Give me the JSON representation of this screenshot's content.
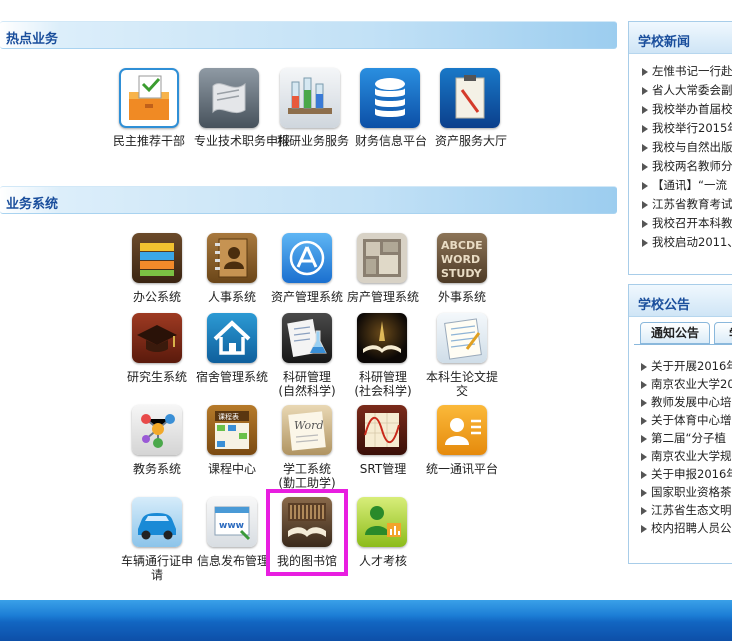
{
  "hot_services": {
    "title": "热点业务",
    "items": [
      {
        "label": "民主推荐干部",
        "icon": "ballot-box-icon"
      },
      {
        "label": "专业技术职务申报",
        "icon": "scroll-icon"
      },
      {
        "label": "科研业务服务",
        "icon": "lab-flasks-icon"
      },
      {
        "label": "财务信息平台",
        "icon": "database-icon"
      },
      {
        "label": "资产服务大厅",
        "icon": "clipboard-icon"
      }
    ]
  },
  "business_systems": {
    "title": "业务系统",
    "items": [
      {
        "label": "办公系统",
        "icon": "folders-icon"
      },
      {
        "label": "人事系统",
        "icon": "address-book-icon"
      },
      {
        "label": "资产管理系统",
        "icon": "app-store-icon"
      },
      {
        "label": "房产管理系统",
        "icon": "floor-plan-icon"
      },
      {
        "label": "外事系统",
        "icon": "abc-letters-icon"
      },
      {
        "label": "研究生系统",
        "icon": "graduation-cap-icon"
      },
      {
        "label": "宿舍管理系统",
        "icon": "house-icon"
      },
      {
        "label": "科研管理\n(自然科学)",
        "icon": "flask-notebook-icon"
      },
      {
        "label": "科研管理\n(社会科学)",
        "icon": "open-book-glow-icon"
      },
      {
        "label": "本科生论文提交",
        "icon": "notebook-icon"
      },
      {
        "label": "教务系统",
        "icon": "molecule-icon"
      },
      {
        "label": "课程中心",
        "icon": "timetable-icon"
      },
      {
        "label": "学工系统\n(勤工助学)",
        "icon": "word-document-icon"
      },
      {
        "label": "SRT管理",
        "icon": "graph-chart-icon"
      },
      {
        "label": "统一通讯平台",
        "icon": "contact-card-icon"
      },
      {
        "label": "车辆通行证申请",
        "icon": "car-icon"
      },
      {
        "label": "信息发布管理",
        "icon": "www-browser-icon"
      },
      {
        "label": "我的图书馆",
        "icon": "library-book-icon"
      },
      {
        "label": "人才考核",
        "icon": "person-chart-icon"
      }
    ]
  },
  "school_news": {
    "title": "学校新闻",
    "items": [
      "左惟书记一行赴",
      "省人大常委会副",
      "我校举办首届校",
      "我校举行2015年",
      "我校与自然出版",
      "我校两名教师分",
      "【通讯】“一流",
      "江苏省教育考试",
      "我校召开本科教",
      "我校启动2011、"
    ]
  },
  "school_notices": {
    "title": "学校公告",
    "tabs": [
      {
        "label": "通知公告"
      },
      {
        "label": "学"
      }
    ],
    "items": [
      "关于开展2016年",
      "南京农业大学20",
      "教师发展中心培",
      "关于体育中心增",
      "第二届“分子植",
      "南京农业大学规",
      "关于申报2016年",
      "国家职业资格茶",
      "江苏省生态文明",
      "校内招聘人员公"
    ]
  },
  "colors": {
    "accent": "#1a4e9c",
    "highlight": "#e81ee0",
    "footer": "#1266c2"
  }
}
